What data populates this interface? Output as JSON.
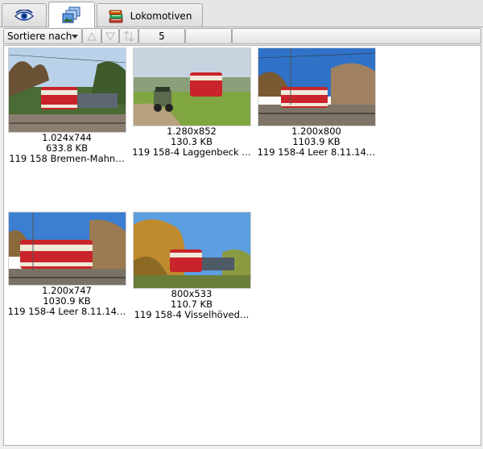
{
  "tabs": [
    {
      "icon": "eye-icon",
      "label": ""
    },
    {
      "icon": "photos-icon",
      "label": ""
    },
    {
      "icon": "books-icon",
      "label": "Lokomotiven"
    }
  ],
  "toolbar": {
    "sort_label": "Sortiere nach",
    "page_value": "5"
  },
  "images": [
    {
      "dimensions": "1.024x744",
      "size": "633.8 KB",
      "name": "119 158 Bremen-Mahn…"
    },
    {
      "dimensions": "1.280x852",
      "size": "130.3 KB",
      "name": "119 158-4 Laggenbeck …"
    },
    {
      "dimensions": "1.200x800",
      "size": "1103.9 KB",
      "name": "119 158-4 Leer 8.11.14…"
    },
    {
      "dimensions": "1.200x747",
      "size": "1030.9 KB",
      "name": "119 158-4 Leer 8.11.14…"
    },
    {
      "dimensions": "800x533",
      "size": "110.7 KB",
      "name": "119 158-4 Visselhöved…"
    }
  ]
}
